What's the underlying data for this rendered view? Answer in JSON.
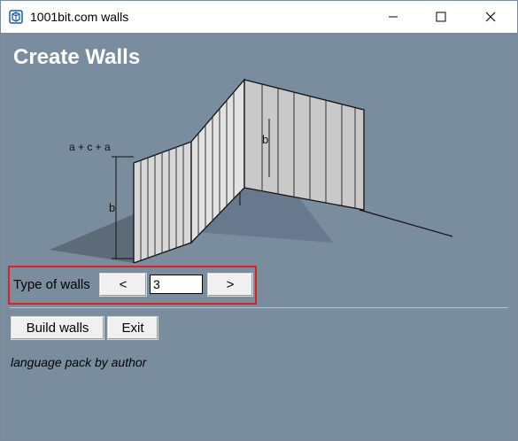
{
  "window": {
    "title": "1001bit.com walls",
    "controls": [
      "minimize-icon",
      "maximize-icon",
      "close-icon"
    ]
  },
  "main": {
    "heading": "Create Walls",
    "illustration": {
      "labels": {
        "top_dimension": "a + c + a",
        "left_height": "b",
        "right_height": "b"
      }
    },
    "type_selector": {
      "label": "Type of walls",
      "prev_label": "<",
      "value": "3",
      "next_label": ">"
    },
    "actions": {
      "build_label": "Build walls",
      "exit_label": "Exit"
    },
    "footer_note": "language pack by author"
  },
  "colors": {
    "background": "#7a8d9f",
    "highlight_border": "#e02020"
  }
}
